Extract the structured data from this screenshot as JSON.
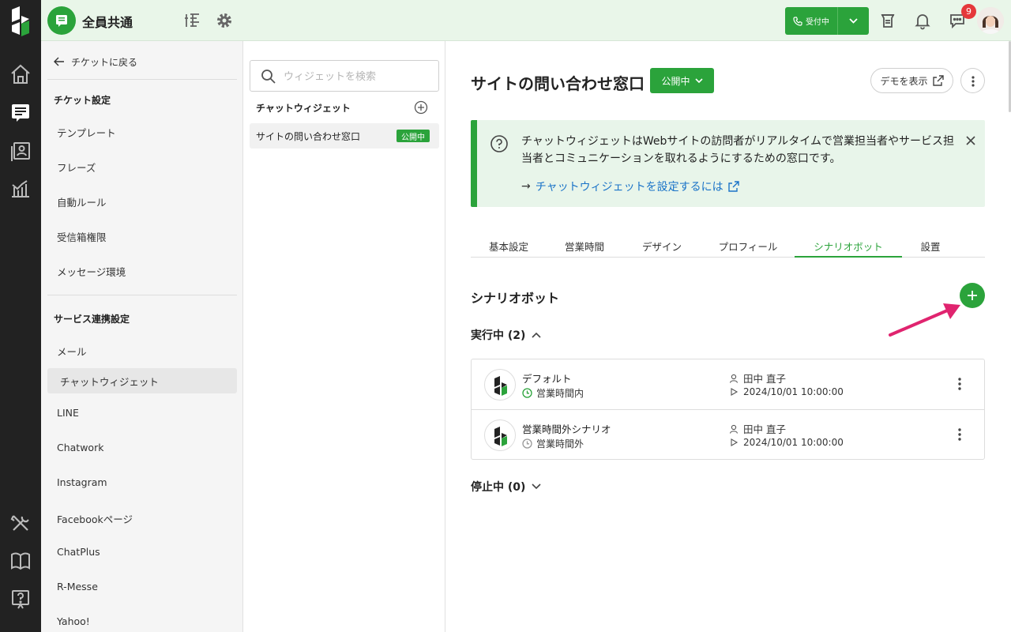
{
  "header": {
    "workspace_title": "全員共通",
    "status_label": "受付中",
    "notification_count": "9",
    "accent_color": "#2ba33b"
  },
  "settings_sidebar": {
    "back_label": "チケットに戻る",
    "ticket_section": "チケット設定",
    "ticket_items": [
      "テンプレート",
      "フレーズ",
      "自動ルール",
      "受信箱権限",
      "メッセージ環境"
    ],
    "integration_section": "サービス連携設定",
    "integration_items": [
      "メール",
      "チャットウィジェット",
      "LINE",
      "Chatwork",
      "Instagram",
      "Facebookページ",
      "ChatPlus",
      "R-Messe",
      "Yahoo!"
    ],
    "active_item": "チャットウィジェット"
  },
  "widget_panel": {
    "search_placeholder": "ウィジェットを検索",
    "group_title": "チャットウィジェット",
    "items": [
      {
        "name": "サイトの問い合わせ窓口",
        "status": "公開中"
      }
    ]
  },
  "main": {
    "title": "サイトの問い合わせ窓口",
    "publish_status": "公開中",
    "demo_label": "デモを表示",
    "info": {
      "text": "チャットウィジェットはWebサイトの訪問者がリアルタイムで営業担当者やサービス担当者とコミュニケーションを取れるようにするための窓口です。",
      "link_prefix": "→",
      "link_label": "チャットウィジェットを設定するには"
    },
    "tabs": [
      "基本設定",
      "営業時間",
      "デザイン",
      "プロフィール",
      "シナリオボット",
      "設置"
    ],
    "active_tab": "シナリオボット",
    "section_title": "シナリオボット",
    "running_label": "実行中 (2)",
    "stopped_label": "停止中 (0)",
    "scenarios": [
      {
        "name": "デフォルト",
        "hours": "営業時間内",
        "owner": "田中 直子",
        "date": "2024/10/01 10:00:00"
      },
      {
        "name": "営業時間外シナリオ",
        "hours": "営業時間外",
        "owner": "田中 直子",
        "date": "2024/10/01 10:00:00"
      }
    ]
  }
}
